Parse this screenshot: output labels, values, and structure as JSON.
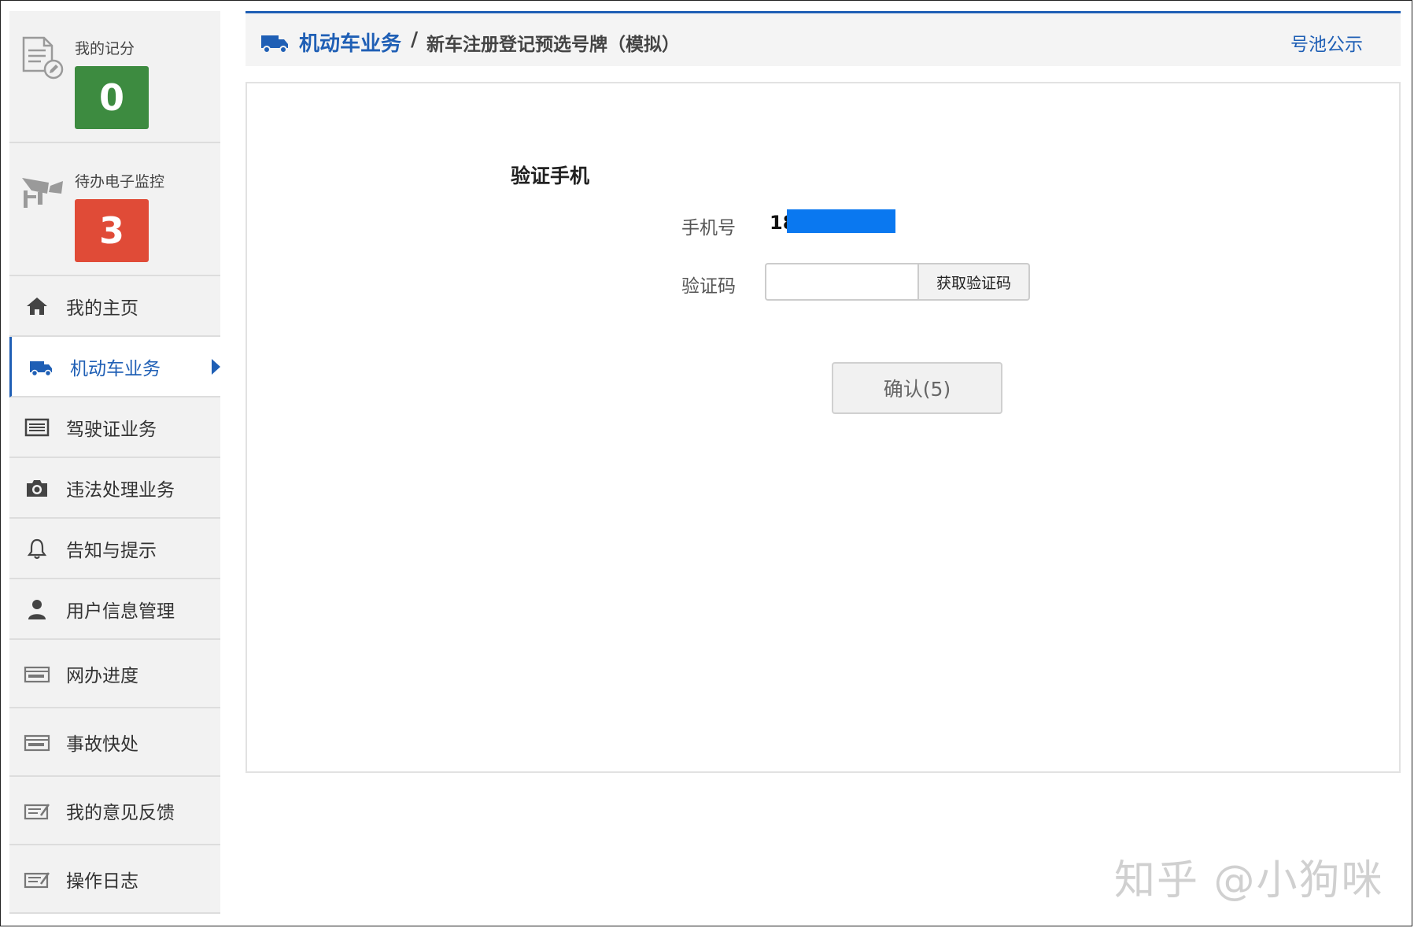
{
  "sidebar": {
    "score_cards": [
      {
        "label": "我的记分",
        "value": "0",
        "color": "#3d8b40",
        "icon": "document-edit-icon"
      },
      {
        "label": "待办电子监控",
        "value": "3",
        "color": "#e04b37",
        "icon": "surveillance-camera-icon"
      }
    ],
    "items": [
      {
        "label": "我的主页",
        "icon": "home-icon"
      },
      {
        "label": "机动车业务",
        "icon": "truck-icon",
        "active": true
      },
      {
        "label": "驾驶证业务",
        "icon": "list-card-icon"
      },
      {
        "label": "违法处理业务",
        "icon": "camera-icon"
      },
      {
        "label": "告知与提示",
        "icon": "bell-icon"
      },
      {
        "label": "用户信息管理",
        "icon": "user-icon"
      },
      {
        "label": "网办进度",
        "icon": "progress-card-icon"
      },
      {
        "label": "事故快处",
        "icon": "accident-card-icon"
      },
      {
        "label": "我的意见反馈",
        "icon": "feedback-card-icon"
      },
      {
        "label": "操作日志",
        "icon": "log-card-icon"
      }
    ]
  },
  "header": {
    "breadcrumb_main": "机动车业务",
    "breadcrumb_sep": "/",
    "breadcrumb_sub": "新车注册登记预选号牌（模拟）",
    "pool_link": "号池公示",
    "accent_color": "#1f5fb5"
  },
  "form": {
    "title": "验证手机",
    "phone_label": "手机号",
    "phone_value": "18",
    "code_label": "验证码",
    "code_value": "",
    "get_code_label": "获取验证码",
    "confirm_label": "确认(5)"
  },
  "watermark": "知乎 @小狗咪"
}
